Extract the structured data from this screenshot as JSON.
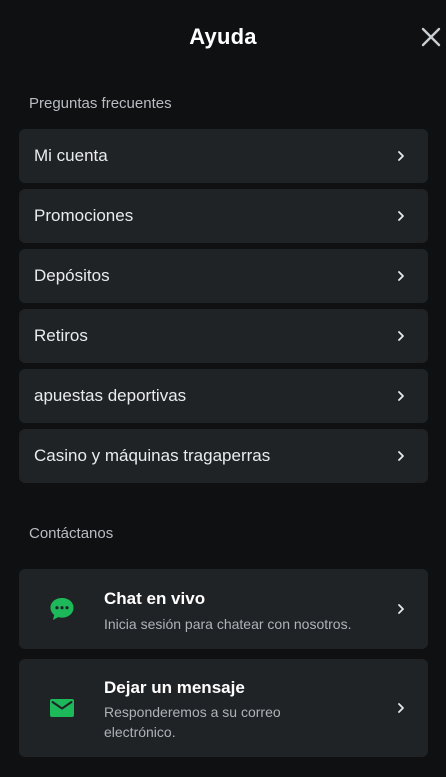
{
  "header": {
    "title": "Ayuda",
    "close_icon": "close-icon"
  },
  "faq": {
    "heading": "Preguntas frecuentes",
    "items": [
      {
        "label": "Mi cuenta"
      },
      {
        "label": "Promociones"
      },
      {
        "label": "Depósitos"
      },
      {
        "label": "Retiros"
      },
      {
        "label": "apuestas deportivas"
      },
      {
        "label": "Casino y máquinas tragaperras"
      }
    ]
  },
  "contact": {
    "heading": "Contáctanos",
    "items": [
      {
        "icon": "chat-icon",
        "title": "Chat en vivo",
        "description": "Inicia sesión para chatear con nosotros."
      },
      {
        "icon": "mail-icon",
        "title": "Dejar un mensaje",
        "description": "Responderemos a su correo electrónico."
      }
    ]
  },
  "colors": {
    "background": "#0e1012",
    "card": "#202326",
    "accent_green": "#1db85a"
  }
}
